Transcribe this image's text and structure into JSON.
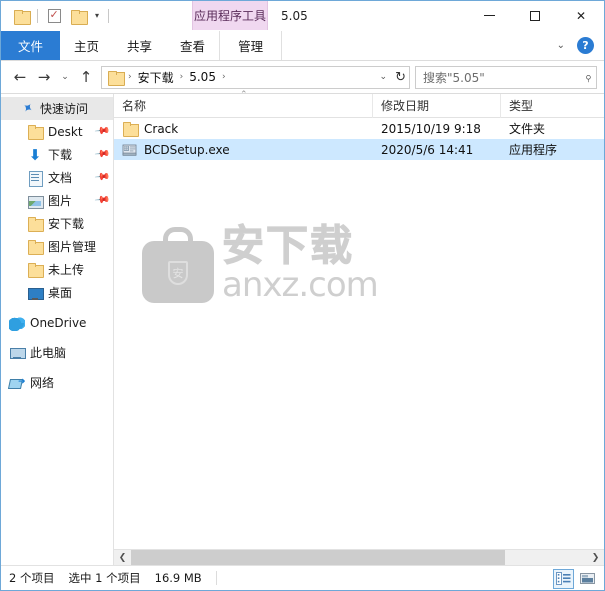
{
  "window": {
    "title": "5.05",
    "contextual_tab_header": "应用程序工具",
    "controls": {
      "minimize": "minimize-icon",
      "maximize": "maximize-icon",
      "close": "close-icon"
    }
  },
  "quick_access_toolbar": {
    "items": [
      {
        "name": "folder-icon",
        "label": ""
      },
      {
        "name": "properties-icon",
        "label": ""
      },
      {
        "name": "new-folder-icon",
        "label": ""
      },
      {
        "name": "customize-caret-icon",
        "label": "▾"
      }
    ]
  },
  "ribbon": {
    "tabs": [
      {
        "label": "文件",
        "active_file": true
      },
      {
        "label": "主页",
        "active_file": false
      },
      {
        "label": "共享",
        "active_file": false
      },
      {
        "label": "查看",
        "active_file": false
      }
    ],
    "contextual_tab": {
      "label": "管理"
    },
    "collapse_caret": "⌄",
    "help_label": "?"
  },
  "address_bar": {
    "back": "←",
    "forward": "→",
    "recent": "⌄",
    "up": "↑",
    "breadcrumbs": [
      "安下载",
      "5.05"
    ],
    "separator": "›",
    "dropdown": "⌄",
    "refresh": "↻",
    "search_placeholder": "搜索\"5.05\"",
    "search_value": "",
    "search_icon": "search-icon"
  },
  "sidebar": {
    "items": [
      {
        "label": "快速访问",
        "icon": "pin-star-icon",
        "type": "quick",
        "pinned": false
      },
      {
        "label": "Deskt",
        "icon": "folder-icon",
        "type": "child",
        "pinned": true
      },
      {
        "label": "下载",
        "icon": "download-icon",
        "type": "child",
        "pinned": true
      },
      {
        "label": "文档",
        "icon": "document-icon",
        "type": "child",
        "pinned": true
      },
      {
        "label": "图片",
        "icon": "pictures-icon",
        "type": "child",
        "pinned": true
      },
      {
        "label": "安下载",
        "icon": "folder-icon",
        "type": "child",
        "pinned": false
      },
      {
        "label": "图片管理",
        "icon": "folder-icon",
        "type": "child",
        "pinned": false
      },
      {
        "label": "未上传",
        "icon": "folder-icon",
        "type": "child",
        "pinned": false
      },
      {
        "label": "桌面",
        "icon": "desktop-icon",
        "type": "child",
        "pinned": false
      },
      {
        "label": "OneDrive",
        "icon": "onedrive-icon",
        "type": "root",
        "pinned": false
      },
      {
        "label": "此电脑",
        "icon": "this-pc-icon",
        "type": "root",
        "pinned": false
      },
      {
        "label": "网络",
        "icon": "network-icon",
        "type": "root",
        "pinned": false
      }
    ]
  },
  "file_list": {
    "columns": [
      {
        "label": "名称"
      },
      {
        "label": "修改日期"
      },
      {
        "label": "类型"
      }
    ],
    "sort_indicator": "⌃",
    "rows": [
      {
        "name": "Crack",
        "date": "2015/10/19 9:18",
        "type": "文件夹",
        "icon": "folder-icon",
        "selected": false
      },
      {
        "name": "BCDSetup.exe",
        "date": "2020/5/6 14:41",
        "type": "应用程序",
        "icon": "executable-icon",
        "selected": true
      }
    ]
  },
  "watermark": {
    "cn_text": "安下载",
    "en_text": "anxz.com",
    "badge_char": "安"
  },
  "scrollbar": {
    "left_arrow": "❮",
    "right_arrow": "❯"
  },
  "status_bar": {
    "item_count": "2 个项目",
    "selection": "选中 1 个项目",
    "size": "16.9 MB",
    "views": [
      {
        "name": "details-view-button",
        "active": true
      },
      {
        "name": "large-icons-view-button",
        "active": false
      }
    ]
  },
  "colors": {
    "accent": "#2b7cd3",
    "selection": "#cde8ff",
    "contextual_tab": "#f0d8f0",
    "folder_yellow": "#fcdf9a",
    "window_border": "#6ea8d8"
  }
}
